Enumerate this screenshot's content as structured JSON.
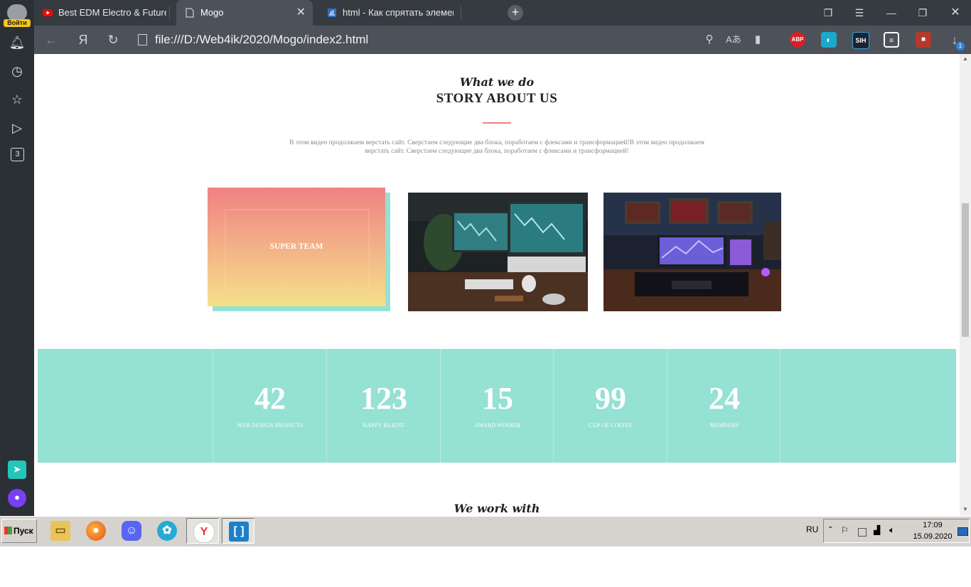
{
  "browser": {
    "tabs": [
      {
        "title": "Best EDM Electro & Future",
        "active": false,
        "icon": "youtube-icon"
      },
      {
        "title": "Mogo",
        "active": true,
        "icon": "page-icon"
      },
      {
        "title": "html - Как спрятать элемент",
        "active": false,
        "icon": "stackoverflow-icon"
      }
    ],
    "new_tab_label": "+",
    "url": "file:///D:/Web4ik/2020/Mogo/index2.html",
    "yandex_label": "Я",
    "extensions": {
      "adblock": "ABP",
      "sih": "SIH",
      "download_count": "1"
    }
  },
  "sidebar": {
    "login_label": "Войти",
    "tabs_count": "3"
  },
  "page": {
    "story": {
      "eyebrow": "What we do",
      "title": "STORY ABOUT US",
      "text": "В этом видео продолжаем верстать сайт. Сверстаем следующие два блока, поработаем с флексами и трансформацией!В этом видео продолжаем верстать сайт. Сверстаем следующие два блока, поработаем с флексами и трансформацией!"
    },
    "cards": {
      "first_label": "SUPER TEAM"
    },
    "stats": [
      {
        "number": "42",
        "label": "WEB DESIGN PROJECTS"
      },
      {
        "number": "123",
        "label": "HAPPY KLIENT"
      },
      {
        "number": "15",
        "label": "AWARD WINNER"
      },
      {
        "number": "99",
        "label": "CUP OF COFFEE"
      },
      {
        "number": "24",
        "label": "MEMBERS"
      }
    ],
    "next_section_eyebrow": "We work with",
    "colors": {
      "accent": "#95e1d3",
      "divider": "#f0807c",
      "gradient_top": "#f08184",
      "gradient_bottom": "#f5e18a"
    }
  },
  "taskbar": {
    "start_label": "Пуск",
    "language": "RU",
    "time": "17:09",
    "date": "15.09.2020"
  }
}
